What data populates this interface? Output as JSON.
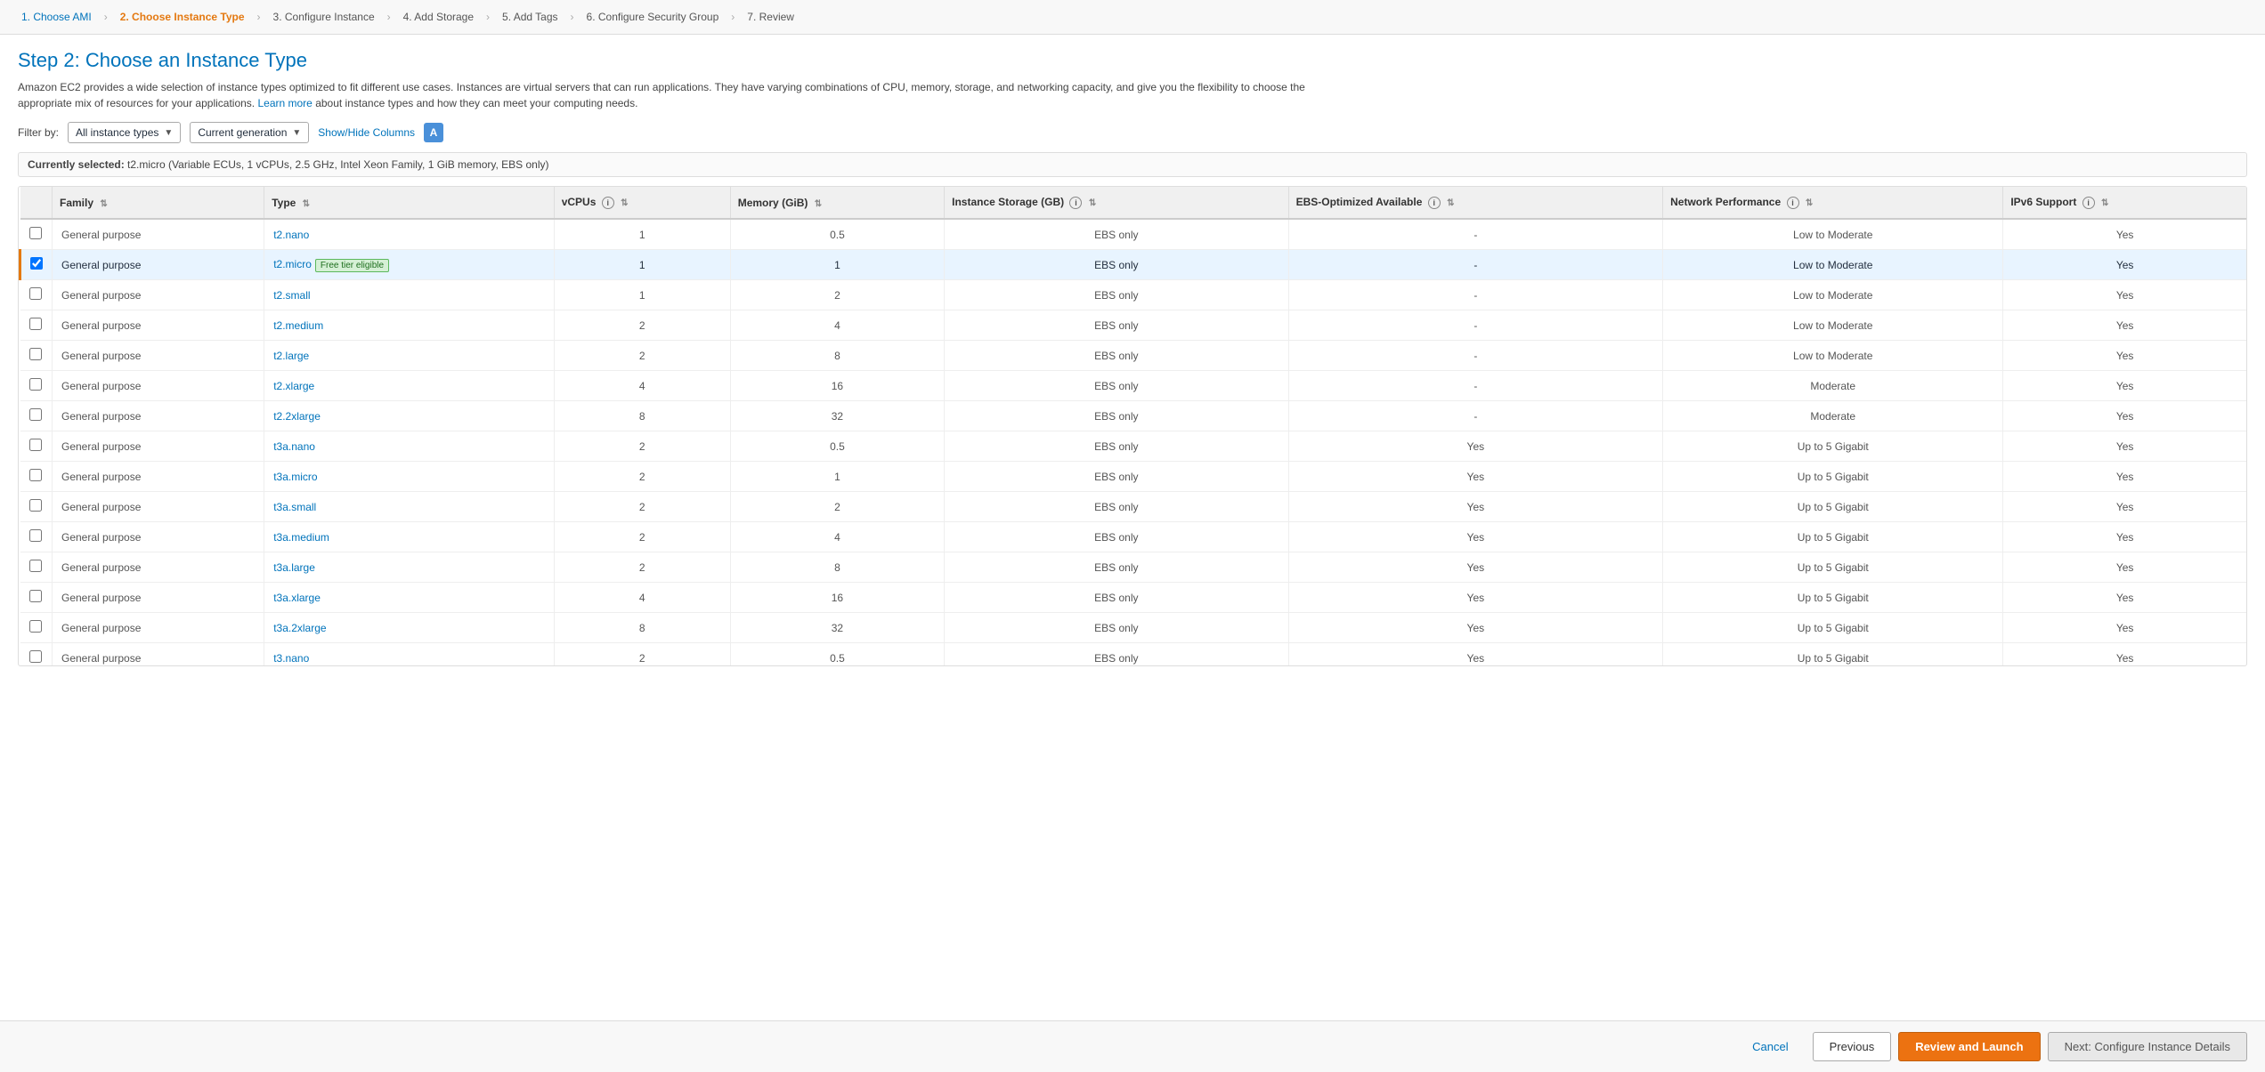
{
  "nav": {
    "steps": [
      {
        "id": 1,
        "label": "1. Choose AMI",
        "state": "completed"
      },
      {
        "id": 2,
        "label": "2. Choose Instance Type",
        "state": "active"
      },
      {
        "id": 3,
        "label": "3. Configure Instance",
        "state": "normal"
      },
      {
        "id": 4,
        "label": "4. Add Storage",
        "state": "normal"
      },
      {
        "id": 5,
        "label": "5. Add Tags",
        "state": "normal"
      },
      {
        "id": 6,
        "label": "6. Configure Security Group",
        "state": "normal"
      },
      {
        "id": 7,
        "label": "7. Review",
        "state": "normal"
      }
    ]
  },
  "page": {
    "title": "Step 2: Choose an Instance Type",
    "description": "Amazon EC2 provides a wide selection of instance types optimized to fit different use cases. Instances are virtual servers that can run applications. They have varying combinations of CPU, memory, storage, and networking capacity, and give you the flexibility to choose the appropriate mix of resources for your applications.",
    "learn_more": "Learn more",
    "learn_more_suffix": " about instance types and how they can meet your computing needs."
  },
  "filter_bar": {
    "filter_label": "Filter by:",
    "filter_value": "All instance types",
    "generation_value": "Current generation",
    "show_hide": "Show/Hide Columns"
  },
  "currently_selected": {
    "label": "Currently selected:",
    "value": "t2.micro (Variable ECUs, 1 vCPUs, 2.5 GHz, Intel Xeon Family, 1 GiB memory, EBS only)"
  },
  "table": {
    "columns": [
      {
        "key": "checkbox",
        "label": ""
      },
      {
        "key": "family",
        "label": "Family",
        "sortable": true
      },
      {
        "key": "type",
        "label": "Type",
        "sortable": true
      },
      {
        "key": "vcpus",
        "label": "vCPUs",
        "sortable": true,
        "info": true
      },
      {
        "key": "memory",
        "label": "Memory (GiB)",
        "sortable": true
      },
      {
        "key": "instance_storage",
        "label": "Instance Storage (GB)",
        "sortable": true,
        "info": true
      },
      {
        "key": "ebs_optimized",
        "label": "EBS-Optimized Available",
        "sortable": true,
        "info": true
      },
      {
        "key": "network",
        "label": "Network Performance",
        "sortable": true,
        "info": true
      },
      {
        "key": "ipv6",
        "label": "IPv6 Support",
        "sortable": true,
        "info": true
      }
    ],
    "rows": [
      {
        "selected": false,
        "family": "General purpose",
        "type": "t2.nano",
        "vcpus": "1",
        "memory": "0.5",
        "storage": "EBS only",
        "ebs_opt": "-",
        "network": "Low to Moderate",
        "ipv6": "Yes",
        "free_tier": false
      },
      {
        "selected": true,
        "family": "General purpose",
        "type": "t2.micro",
        "vcpus": "1",
        "memory": "1",
        "storage": "EBS only",
        "ebs_opt": "-",
        "network": "Low to Moderate",
        "ipv6": "Yes",
        "free_tier": true
      },
      {
        "selected": false,
        "family": "General purpose",
        "type": "t2.small",
        "vcpus": "1",
        "memory": "2",
        "storage": "EBS only",
        "ebs_opt": "-",
        "network": "Low to Moderate",
        "ipv6": "Yes",
        "free_tier": false
      },
      {
        "selected": false,
        "family": "General purpose",
        "type": "t2.medium",
        "vcpus": "2",
        "memory": "4",
        "storage": "EBS only",
        "ebs_opt": "-",
        "network": "Low to Moderate",
        "ipv6": "Yes",
        "free_tier": false
      },
      {
        "selected": false,
        "family": "General purpose",
        "type": "t2.large",
        "vcpus": "2",
        "memory": "8",
        "storage": "EBS only",
        "ebs_opt": "-",
        "network": "Low to Moderate",
        "ipv6": "Yes",
        "free_tier": false
      },
      {
        "selected": false,
        "family": "General purpose",
        "type": "t2.xlarge",
        "vcpus": "4",
        "memory": "16",
        "storage": "EBS only",
        "ebs_opt": "-",
        "network": "Moderate",
        "ipv6": "Yes",
        "free_tier": false
      },
      {
        "selected": false,
        "family": "General purpose",
        "type": "t2.2xlarge",
        "vcpus": "8",
        "memory": "32",
        "storage": "EBS only",
        "ebs_opt": "-",
        "network": "Moderate",
        "ipv6": "Yes",
        "free_tier": false
      },
      {
        "selected": false,
        "family": "General purpose",
        "type": "t3a.nano",
        "vcpus": "2",
        "memory": "0.5",
        "storage": "EBS only",
        "ebs_opt": "Yes",
        "network": "Up to 5 Gigabit",
        "ipv6": "Yes",
        "free_tier": false
      },
      {
        "selected": false,
        "family": "General purpose",
        "type": "t3a.micro",
        "vcpus": "2",
        "memory": "1",
        "storage": "EBS only",
        "ebs_opt": "Yes",
        "network": "Up to 5 Gigabit",
        "ipv6": "Yes",
        "free_tier": false
      },
      {
        "selected": false,
        "family": "General purpose",
        "type": "t3a.small",
        "vcpus": "2",
        "memory": "2",
        "storage": "EBS only",
        "ebs_opt": "Yes",
        "network": "Up to 5 Gigabit",
        "ipv6": "Yes",
        "free_tier": false
      },
      {
        "selected": false,
        "family": "General purpose",
        "type": "t3a.medium",
        "vcpus": "2",
        "memory": "4",
        "storage": "EBS only",
        "ebs_opt": "Yes",
        "network": "Up to 5 Gigabit",
        "ipv6": "Yes",
        "free_tier": false
      },
      {
        "selected": false,
        "family": "General purpose",
        "type": "t3a.large",
        "vcpus": "2",
        "memory": "8",
        "storage": "EBS only",
        "ebs_opt": "Yes",
        "network": "Up to 5 Gigabit",
        "ipv6": "Yes",
        "free_tier": false
      },
      {
        "selected": false,
        "family": "General purpose",
        "type": "t3a.xlarge",
        "vcpus": "4",
        "memory": "16",
        "storage": "EBS only",
        "ebs_opt": "Yes",
        "network": "Up to 5 Gigabit",
        "ipv6": "Yes",
        "free_tier": false
      },
      {
        "selected": false,
        "family": "General purpose",
        "type": "t3a.2xlarge",
        "vcpus": "8",
        "memory": "32",
        "storage": "EBS only",
        "ebs_opt": "Yes",
        "network": "Up to 5 Gigabit",
        "ipv6": "Yes",
        "free_tier": false
      },
      {
        "selected": false,
        "family": "General purpose",
        "type": "t3.nano",
        "vcpus": "2",
        "memory": "0.5",
        "storage": "EBS only",
        "ebs_opt": "Yes",
        "network": "Up to 5 Gigabit",
        "ipv6": "Yes",
        "free_tier": false
      }
    ]
  },
  "buttons": {
    "cancel": "Cancel",
    "previous": "Previous",
    "review_and_launch": "Review and Launch",
    "next": "Next: Configure Instance Details"
  }
}
